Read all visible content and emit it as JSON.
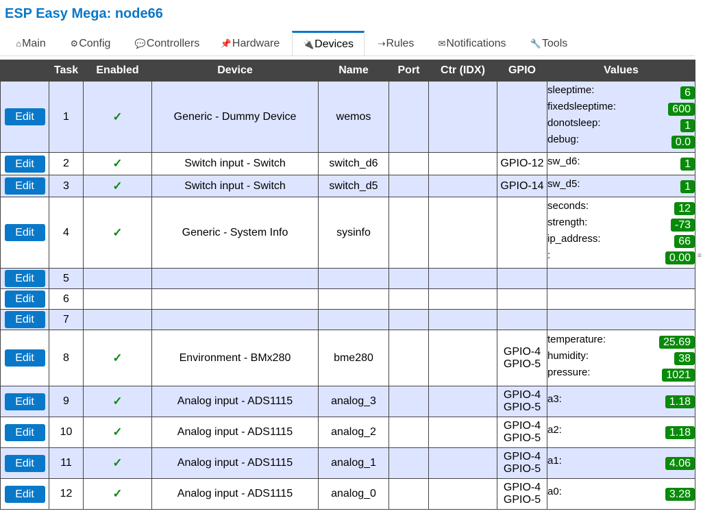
{
  "app": {
    "title": "ESP Easy Mega: node66"
  },
  "tabs": [
    {
      "label": "Main",
      "icon": "⌂"
    },
    {
      "label": "Config",
      "icon": "⚙"
    },
    {
      "label": "Controllers",
      "icon": "💬"
    },
    {
      "label": "Hardware",
      "icon": "📌"
    },
    {
      "label": "Devices",
      "icon": "🔌",
      "active": true
    },
    {
      "label": "Rules",
      "icon": "⇢"
    },
    {
      "label": "Notifications",
      "icon": "✉"
    },
    {
      "label": "Tools",
      "icon": "🔧"
    }
  ],
  "table": {
    "headers": [
      "",
      "Task",
      "Enabled",
      "Device",
      "Name",
      "Port",
      "Ctr (IDX)",
      "GPIO",
      "Values"
    ],
    "edit_label": "Edit",
    "check_mark": "✓",
    "rows": [
      {
        "task": "1",
        "enabled": true,
        "device": "Generic - Dummy Device",
        "name": "wemos",
        "gpio": [],
        "values": [
          {
            "name": "sleeptime:",
            "value": "6"
          },
          {
            "name": "fixedsleeptime:",
            "value": "600"
          },
          {
            "name": "donotsleep:",
            "value": "1"
          },
          {
            "name": "debug:",
            "value": "0.0"
          }
        ]
      },
      {
        "task": "2",
        "enabled": true,
        "device": "Switch input - Switch",
        "name": "switch_d6",
        "gpio": [
          "GPIO-12"
        ],
        "values": [
          {
            "name": "sw_d6:",
            "value": "1"
          }
        ]
      },
      {
        "task": "3",
        "enabled": true,
        "device": "Switch input - Switch",
        "name": "switch_d5",
        "gpio": [
          "GPIO-14"
        ],
        "values": [
          {
            "name": "sw_d5:",
            "value": "1"
          }
        ]
      },
      {
        "task": "4",
        "enabled": true,
        "device": "Generic - System Info",
        "name": "sysinfo",
        "gpio": [],
        "values": [
          {
            "name": "seconds:",
            "value": "12"
          },
          {
            "name": "strength:",
            "value": "-73"
          },
          {
            "name": "ip_address:",
            "value": "66"
          },
          {
            "name": ":",
            "value": "0.00"
          }
        ]
      },
      {
        "task": "5",
        "enabled": false,
        "device": "",
        "name": "",
        "gpio": [],
        "values": []
      },
      {
        "task": "6",
        "enabled": false,
        "device": "",
        "name": "",
        "gpio": [],
        "values": []
      },
      {
        "task": "7",
        "enabled": false,
        "device": "",
        "name": "",
        "gpio": [],
        "values": []
      },
      {
        "task": "8",
        "enabled": true,
        "device": "Environment - BMx280",
        "name": "bme280",
        "gpio": [
          "GPIO-4",
          "GPIO-5"
        ],
        "values": [
          {
            "name": "temperature:",
            "value": "25.69"
          },
          {
            "name": "humidity:",
            "value": "38"
          },
          {
            "name": "pressure:",
            "value": "1021"
          }
        ]
      },
      {
        "task": "9",
        "enabled": true,
        "device": "Analog input - ADS1115",
        "name": "analog_3",
        "gpio": [
          "GPIO-4",
          "GPIO-5"
        ],
        "values": [
          {
            "name": "a3:",
            "value": "1.18"
          }
        ]
      },
      {
        "task": "10",
        "enabled": true,
        "device": "Analog input - ADS1115",
        "name": "analog_2",
        "gpio": [
          "GPIO-4",
          "GPIO-5"
        ],
        "values": [
          {
            "name": "a2:",
            "value": "1.18"
          }
        ]
      },
      {
        "task": "11",
        "enabled": true,
        "device": "Analog input - ADS1115",
        "name": "analog_1",
        "gpio": [
          "GPIO-4",
          "GPIO-5"
        ],
        "values": [
          {
            "name": "a1:",
            "value": "4.06"
          }
        ]
      },
      {
        "task": "12",
        "enabled": true,
        "device": "Analog input - ADS1115",
        "name": "analog_0",
        "gpio": [
          "GPIO-4",
          "GPIO-5"
        ],
        "values": [
          {
            "name": "a0:",
            "value": "3.28"
          }
        ]
      }
    ]
  },
  "colors": {
    "accent": "#0a78c8",
    "header_bg": "#444444",
    "row_alt": "#dde4ff",
    "value_badge": "#0a8a0a",
    "check": "#0a8a0a"
  },
  "scrollbar": {
    "indicator": "≡"
  }
}
